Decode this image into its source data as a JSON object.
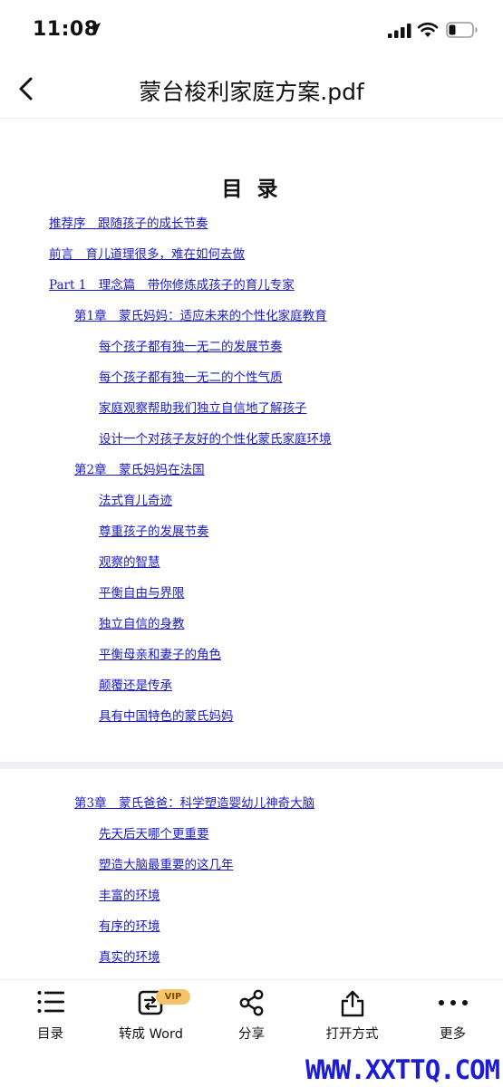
{
  "status_bar": {
    "time": "11:08"
  },
  "header": {
    "title": "蒙台梭利家庭方案.pdf"
  },
  "page1": {
    "heading": "目 录",
    "items": [
      {
        "text": "推荐序　跟随孩子的成长节奏",
        "level": 1
      },
      {
        "text": "前言　育儿道理很多，难在如何去做",
        "level": 1
      },
      {
        "text": "Part 1　理念篇　带你修炼成孩子的育儿专家",
        "level": 1
      },
      {
        "text": "第1章　蒙氏妈妈：适应未来的个性化家庭教育",
        "level": 2
      },
      {
        "text": "每个孩子都有独一无二的发展节奏",
        "level": 3
      },
      {
        "text": "每个孩子都有独一无二的个性气质",
        "level": 3
      },
      {
        "text": "家庭观察帮助我们独立自信地了解孩子",
        "level": 3
      },
      {
        "text": "设计一个对孩子友好的个性化蒙氏家庭环境",
        "level": 3
      },
      {
        "text": "第2章　蒙氏妈妈在法国",
        "level": 2
      },
      {
        "text": "法式育儿奇迹",
        "level": 3
      },
      {
        "text": "尊重孩子的发展节奏",
        "level": 3
      },
      {
        "text": "观察的智慧",
        "level": 3
      },
      {
        "text": "平衡自由与界限",
        "level": 3
      },
      {
        "text": "独立自信的身教",
        "level": 3
      },
      {
        "text": "平衡母亲和妻子的角色",
        "level": 3
      },
      {
        "text": "颠覆还是传承",
        "level": 3
      },
      {
        "text": "具有中国特色的蒙氏妈妈",
        "level": 3
      }
    ]
  },
  "page2": {
    "items": [
      {
        "text": "第3章　蒙氏爸爸：科学塑造婴幼儿神奇大脑",
        "level": 2
      },
      {
        "text": "先天后天哪个更重要",
        "level": 3
      },
      {
        "text": "塑造大脑最重要的这几年",
        "level": 3
      },
      {
        "text": "丰富的环境",
        "level": 3
      },
      {
        "text": "有序的环境",
        "level": 3
      },
      {
        "text": "真实的环境",
        "level": 3
      }
    ]
  },
  "toolbar": {
    "toc_label": "目录",
    "word_label": "转成 Word",
    "vip_badge": "VIP",
    "share_label": "分享",
    "open_with_label": "打开方式",
    "more_label": "更多"
  },
  "watermark": "WWW.XXTTQ.COM",
  "colors": {
    "link": "#1a1ac8",
    "vip_badge": "#f5c46a",
    "watermark": "#1c1cd6"
  }
}
